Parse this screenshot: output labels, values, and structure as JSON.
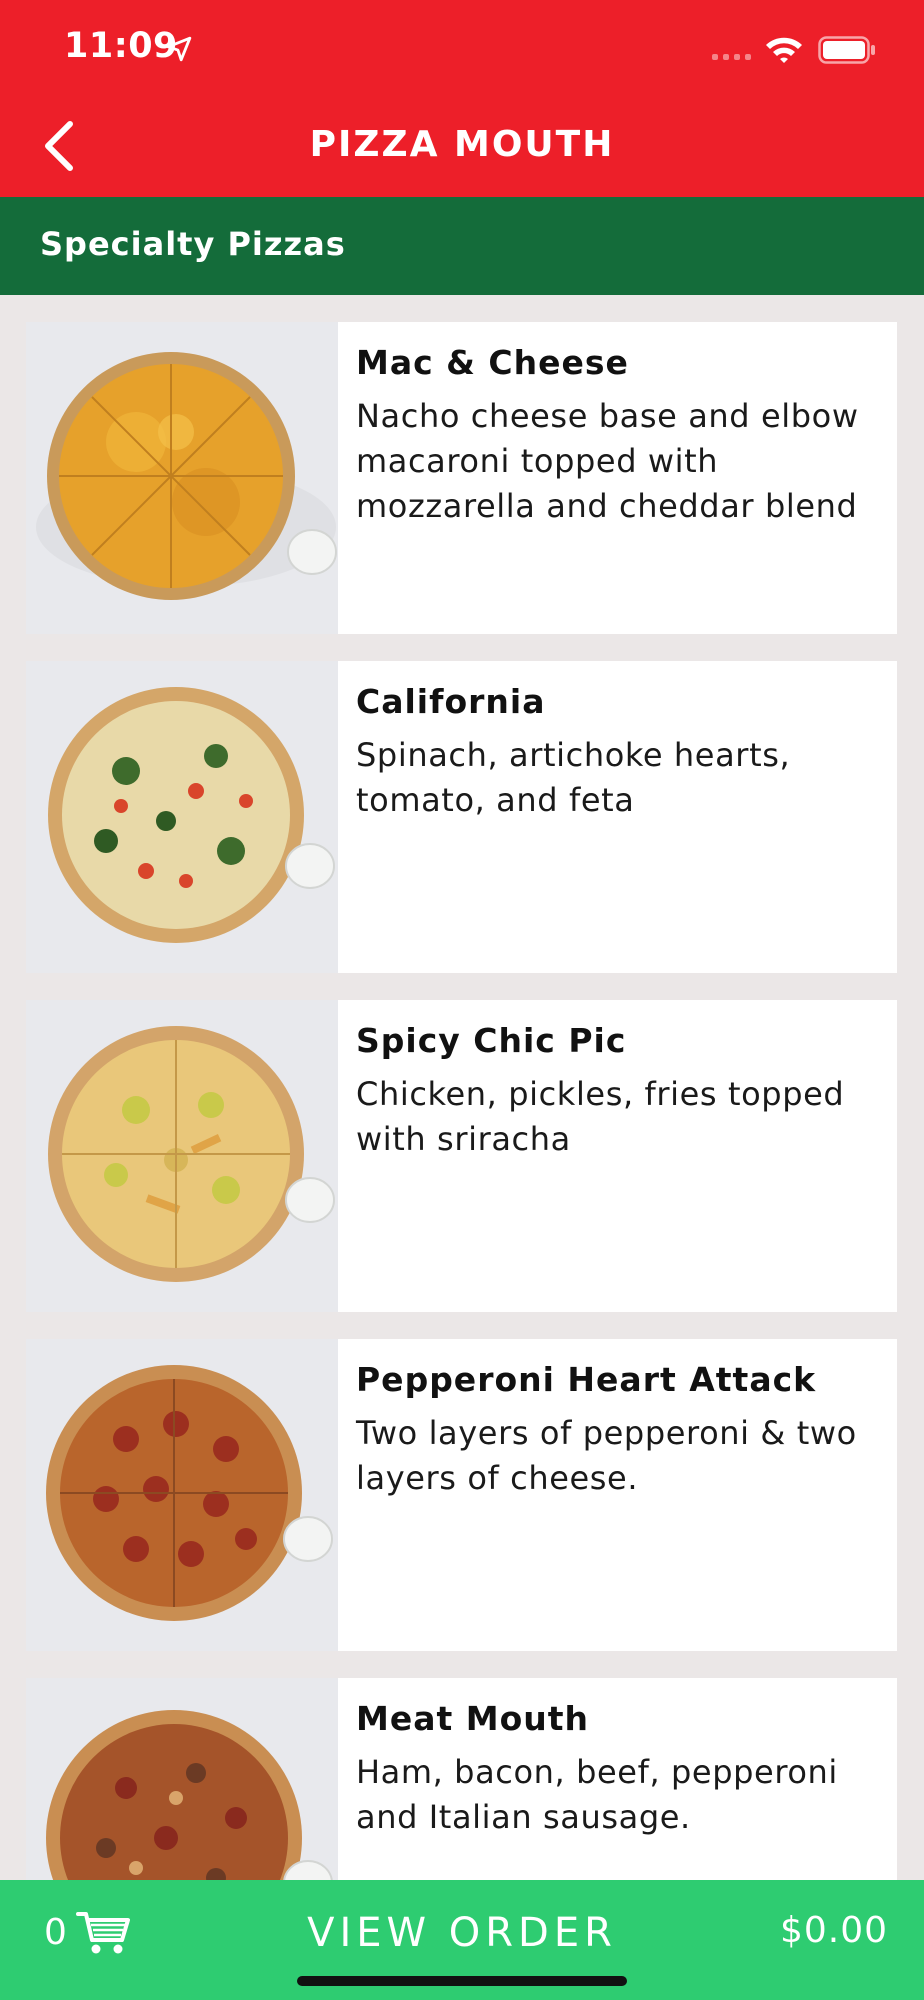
{
  "status_bar": {
    "time": "11:09"
  },
  "header": {
    "title": "PIZZA MOUTH"
  },
  "section": {
    "title": "Specialty Pizzas"
  },
  "items": [
    {
      "name": "Mac & Cheese",
      "description": "Nacho cheese base and elbow macaroni topped with mozzarella and cheddar blend"
    },
    {
      "name": "California",
      "description": "Spinach, artichoke hearts, tomato, and feta"
    },
    {
      "name": "Spicy Chic Pic",
      "description": "Chicken, pickles, fries topped with sriracha"
    },
    {
      "name": "Pepperoni Heart Attack",
      "description": "Two layers of pepperoni & two layers of cheese."
    },
    {
      "name": "Meat Mouth",
      "description": "Ham, bacon, beef, pepperoni and Italian sausage."
    }
  ],
  "footer": {
    "cart_count": "0",
    "view_order_label": "VIEW ORDER",
    "total": "$0.00"
  },
  "colors": {
    "header": "#ed1f29",
    "section": "#146c3a",
    "footer": "#2ecc71",
    "background": "#ebe7e7"
  }
}
